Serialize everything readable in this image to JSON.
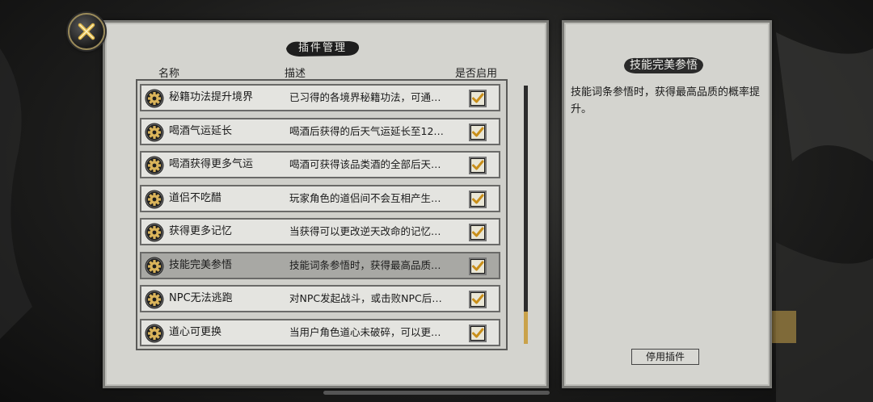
{
  "main": {
    "title": "插件管理",
    "columns": {
      "name": "名称",
      "desc": "描述",
      "enabled": "是否启用"
    },
    "plugins": [
      {
        "name": "秘籍功法提升境界",
        "desc": "已习得的各境界秘籍功法，可通…",
        "enabled": true,
        "selected": false
      },
      {
        "name": "喝酒气运延长",
        "desc": "喝酒后获得的后天气运延长至12…",
        "enabled": true,
        "selected": false
      },
      {
        "name": "喝酒获得更多气运",
        "desc": "喝酒可获得该品类酒的全部后天…",
        "enabled": true,
        "selected": false
      },
      {
        "name": "道侣不吃醋",
        "desc": "玩家角色的道侣间不会互相产生…",
        "enabled": true,
        "selected": false
      },
      {
        "name": "获得更多记忆",
        "desc": "当获得可以更改逆天改命的记忆…",
        "enabled": true,
        "selected": false
      },
      {
        "name": "技能完美参悟",
        "desc": "技能词条参悟时，获得最高品质…",
        "enabled": true,
        "selected": true
      },
      {
        "name": "NPC无法逃跑",
        "desc": "对NPC发起战斗，或击败NPC后…",
        "enabled": true,
        "selected": false
      },
      {
        "name": "道心可更换",
        "desc": "当用户角色道心未破碎，可以更…",
        "enabled": true,
        "selected": false
      }
    ]
  },
  "detail": {
    "title": "技能完美参悟",
    "description": "技能词条参悟时，获得最高品质的概率提升。",
    "disable_button": "停用插件"
  },
  "icons": {
    "close": "close-x-icon",
    "plugin": "gear-icon",
    "check": "checkmark-icon"
  },
  "colors": {
    "accent_gold": "#c9a24a",
    "panel_bg": "#d4d4cf",
    "selected_row": "#a8a8a4"
  }
}
